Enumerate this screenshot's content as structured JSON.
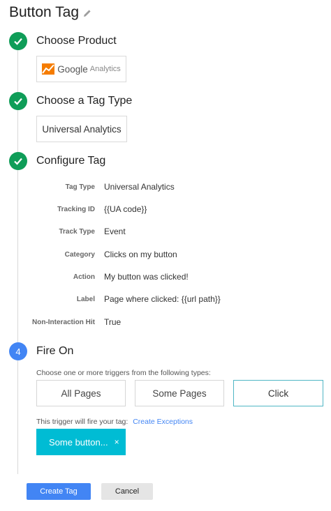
{
  "page": {
    "title": "Button Tag"
  },
  "colors": {
    "done": "#0f9d58",
    "active": "#4285f4",
    "chip": "#00bcd4",
    "link": "#4285f4"
  },
  "steps": {
    "product": {
      "title": "Choose Product",
      "logo_text": "Google",
      "logo_subtext": "Analytics"
    },
    "tag_type": {
      "title": "Choose a Tag Type",
      "value": "Universal Analytics"
    },
    "configure": {
      "title": "Configure Tag",
      "rows": [
        {
          "label": "Tag Type",
          "value": "Universal Analytics"
        },
        {
          "label": "Tracking ID",
          "value": "{{UA code}}"
        },
        {
          "label": "Track Type",
          "value": "Event"
        },
        {
          "label": "Category",
          "value": "Clicks on my button"
        },
        {
          "label": "Action",
          "value": "My button was clicked!"
        },
        {
          "label": "Label",
          "value": "Page where clicked: {{url path}}"
        },
        {
          "label": "Non-Interaction Hit",
          "value": "True"
        }
      ]
    },
    "fire_on": {
      "number": "4",
      "title": "Fire On",
      "hint": "Choose one or more triggers from the following types:",
      "triggers": [
        "All Pages",
        "Some Pages",
        "Click"
      ],
      "selected_trigger": "Click",
      "trigger_note": "This trigger will fire your tag:",
      "exceptions_link": "Create Exceptions",
      "chip_label": "Some button...",
      "chip_close": "×"
    }
  },
  "actions": {
    "create": "Create Tag",
    "cancel": "Cancel"
  }
}
